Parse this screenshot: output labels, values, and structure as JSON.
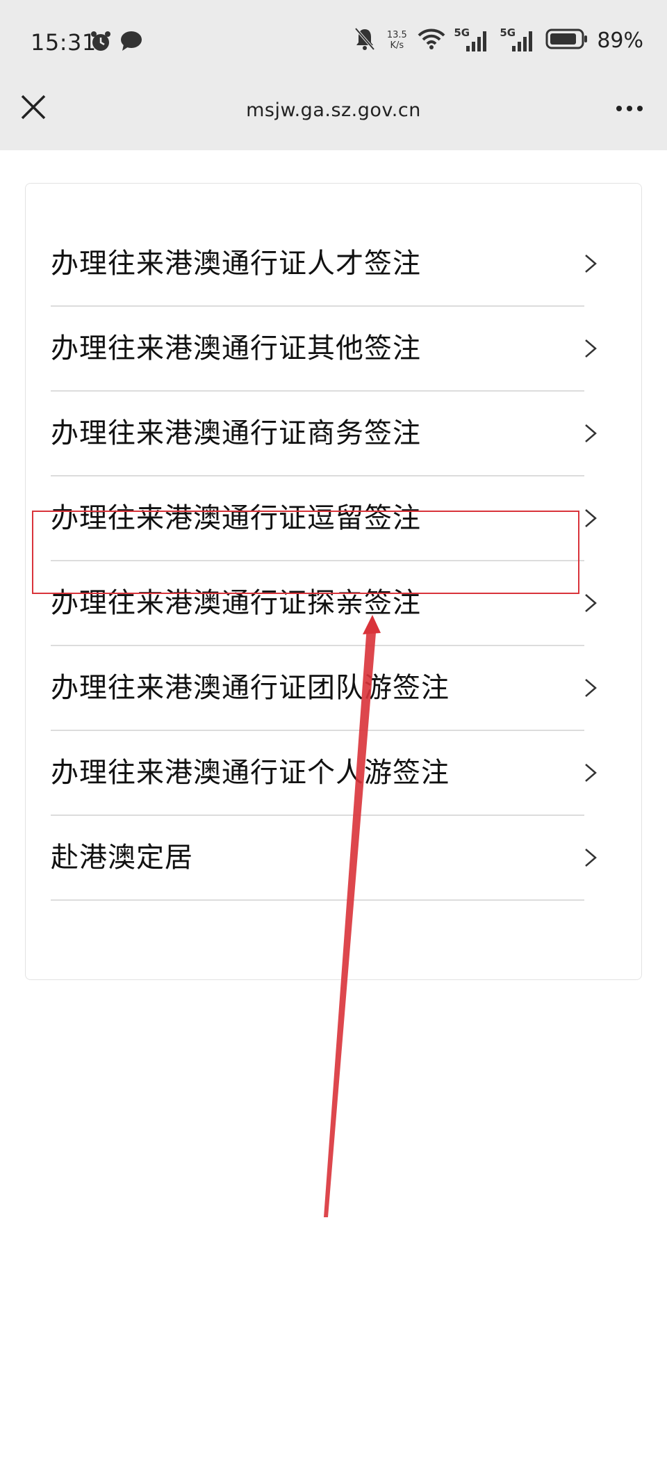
{
  "status_bar": {
    "time": "15:31",
    "left_icons": [
      "alarm-icon",
      "chat-icon"
    ],
    "right_icons": [
      "mute-icon",
      "wifi-icon",
      "signal-5g-icon",
      "signal-5g-icon",
      "battery-icon"
    ],
    "net_speed_value": "13.5",
    "net_speed_unit": "K/s",
    "network_1": "5G",
    "network_2": "5G",
    "battery_percent": "89%",
    "battery_level": 0.89
  },
  "browser": {
    "title": "msjw.ga.sz.gov.cn",
    "close_icon": "close-icon",
    "more_icon": "more-dots-icon"
  },
  "menu": {
    "items": [
      {
        "label": "办理往来港澳通行证人才签注"
      },
      {
        "label": "办理往来港澳通行证其他签注"
      },
      {
        "label": "办理往来港澳通行证商务签注"
      },
      {
        "label": "办理往来港澳通行证逗留签注"
      },
      {
        "label": "办理往来港澳通行证探亲签注"
      },
      {
        "label": "办理往来港澳通行证团队游签注"
      },
      {
        "label": "办理往来港澳通行证个人游签注"
      },
      {
        "label": "赴港澳定居"
      }
    ],
    "chevron_icon": "chevron-right-icon"
  },
  "annotation": {
    "highlight_color": "#d9333a",
    "highlighted_item": "办理往来港澳通行证逗留签注"
  }
}
